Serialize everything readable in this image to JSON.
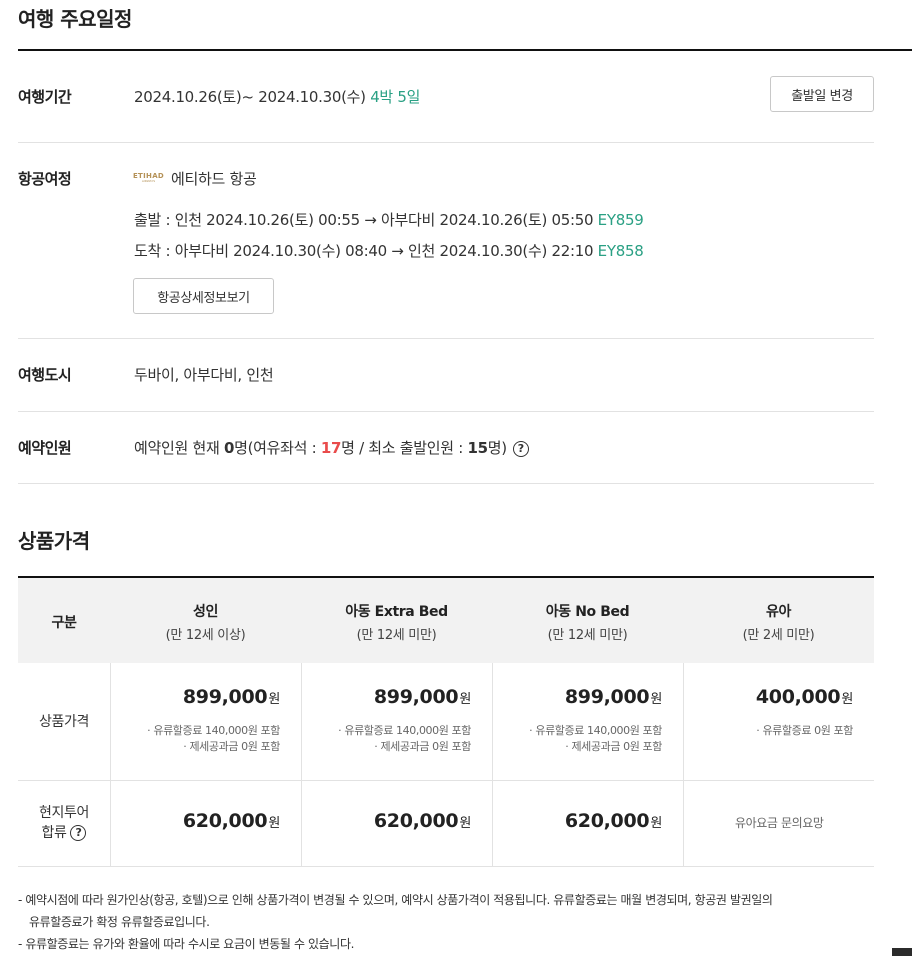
{
  "sections": {
    "itinerary_title": "여행 주요일정",
    "price_title": "상품가격"
  },
  "period": {
    "label": "여행기간",
    "dates": "2024.10.26(토)~ 2024.10.30(수)",
    "duration": "4박 5일",
    "change_button": "출발일 변경"
  },
  "flight": {
    "label": "항공여정",
    "logo_text": "ETIHAD",
    "logo_sub": "AIRWAYS",
    "airline": "에티하드 항공",
    "departure_text": "출발 : 인천 2024.10.26(토) 00:55 → 아부다비 2024.10.26(토) 05:50",
    "departure_code": "EY859",
    "arrival_text": "도착 : 아부다비 2024.10.30(수) 08:40 → 인천 2024.10.30(수) 22:10",
    "arrival_code": "EY858",
    "detail_button": "항공상세정보보기"
  },
  "cities": {
    "label": "여행도시",
    "value": "두바이, 아부다비, 인천"
  },
  "reservation": {
    "label": "예약인원",
    "prefix": "예약인원 현재 ",
    "current": "0",
    "mid1": "명(여유좌석 : ",
    "seats": "17",
    "mid2": "명 / 최소 출발인원 : ",
    "minimum": "15",
    "suffix": "명)",
    "help_icon": "?"
  },
  "table": {
    "corner": "구분",
    "columns": [
      {
        "main": "성인",
        "sub": "(만 12세 이상)"
      },
      {
        "main": "아동 Extra Bed",
        "sub": "(만 12세 미만)"
      },
      {
        "main": "아동 No Bed",
        "sub": "(만 12세 미만)"
      },
      {
        "main": "유아",
        "sub": "(만 2세 미만)"
      }
    ],
    "price_row_label": "상품가격",
    "prices": [
      {
        "amount": "899,000",
        "unit": "원",
        "note1": "· 유류할증료 140,000원 포함",
        "note2": "· 제세공과금 0원 포함"
      },
      {
        "amount": "899,000",
        "unit": "원",
        "note1": "· 유류할증료 140,000원 포함",
        "note2": "· 제세공과금 0원 포함"
      },
      {
        "amount": "899,000",
        "unit": "원",
        "note1": "· 유류할증료 140,000원 포함",
        "note2": "· 제세공과금 0원 포함"
      },
      {
        "amount": "400,000",
        "unit": "원",
        "note1": "· 유류할증료 0원 포함",
        "note2": ""
      }
    ],
    "tour_row_label_1": "현지투어",
    "tour_row_label_2": "합류",
    "tour": [
      {
        "amount": "620,000",
        "unit": "원"
      },
      {
        "amount": "620,000",
        "unit": "원"
      },
      {
        "amount": "620,000",
        "unit": "원"
      }
    ],
    "tour_infant": "유아요금 문의요망"
  },
  "footnotes": {
    "line1": "- 예약시점에 따라 원가인상(항공, 호텔)으로 인해 상품가격이 변경될 수 있으며, 예약시 상품가격이 적용됩니다. 유류할증료는 매월 변경되며, 항공권 발권일의",
    "line2": "유류할증료가 확정 유류할증료입니다.",
    "line3": "- 유류할증료는 유가와 환율에 따라 수시로 요금이 변동될 수 있습니다."
  }
}
